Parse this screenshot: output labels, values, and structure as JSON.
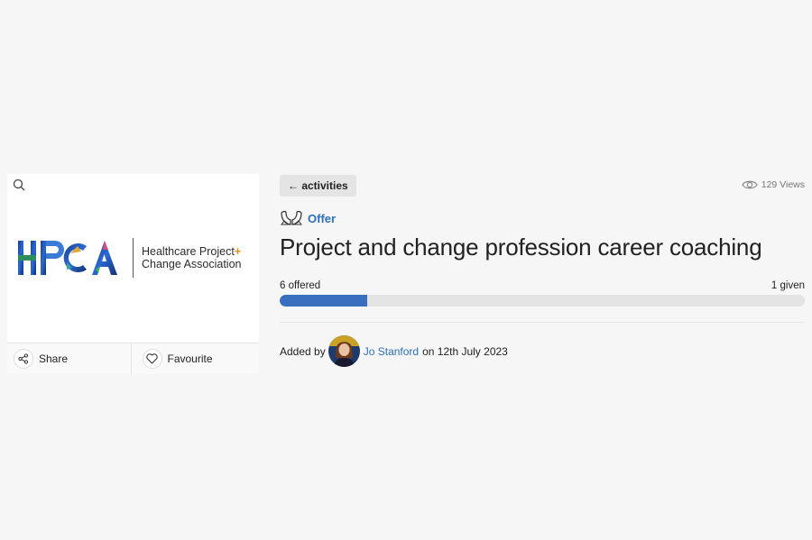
{
  "card": {
    "logo_text_line1": "Healthcare Project",
    "logo_plus": "+",
    "logo_text_line2": "Change Association",
    "share_label": "Share",
    "favourite_label": "Favourite"
  },
  "nav": {
    "back_label": "← activities"
  },
  "stats": {
    "views": "129 Views"
  },
  "listing": {
    "type": "Offer",
    "title": "Project and change profession career coaching",
    "offered_label": "6 offered",
    "given_label": "1 given",
    "progress_fraction": 0.1667
  },
  "author": {
    "prefix": "Added by",
    "name": "Jo Stanford",
    "date_text": "on 12th July 2023"
  },
  "colors": {
    "accent": "#2d6fb8",
    "progress": "#3a6fbf",
    "logo_plus": "#e98a1d"
  },
  "icons": [
    "search-icon",
    "share-icon",
    "heart-icon",
    "eye-icon",
    "offer-hands-icon"
  ]
}
